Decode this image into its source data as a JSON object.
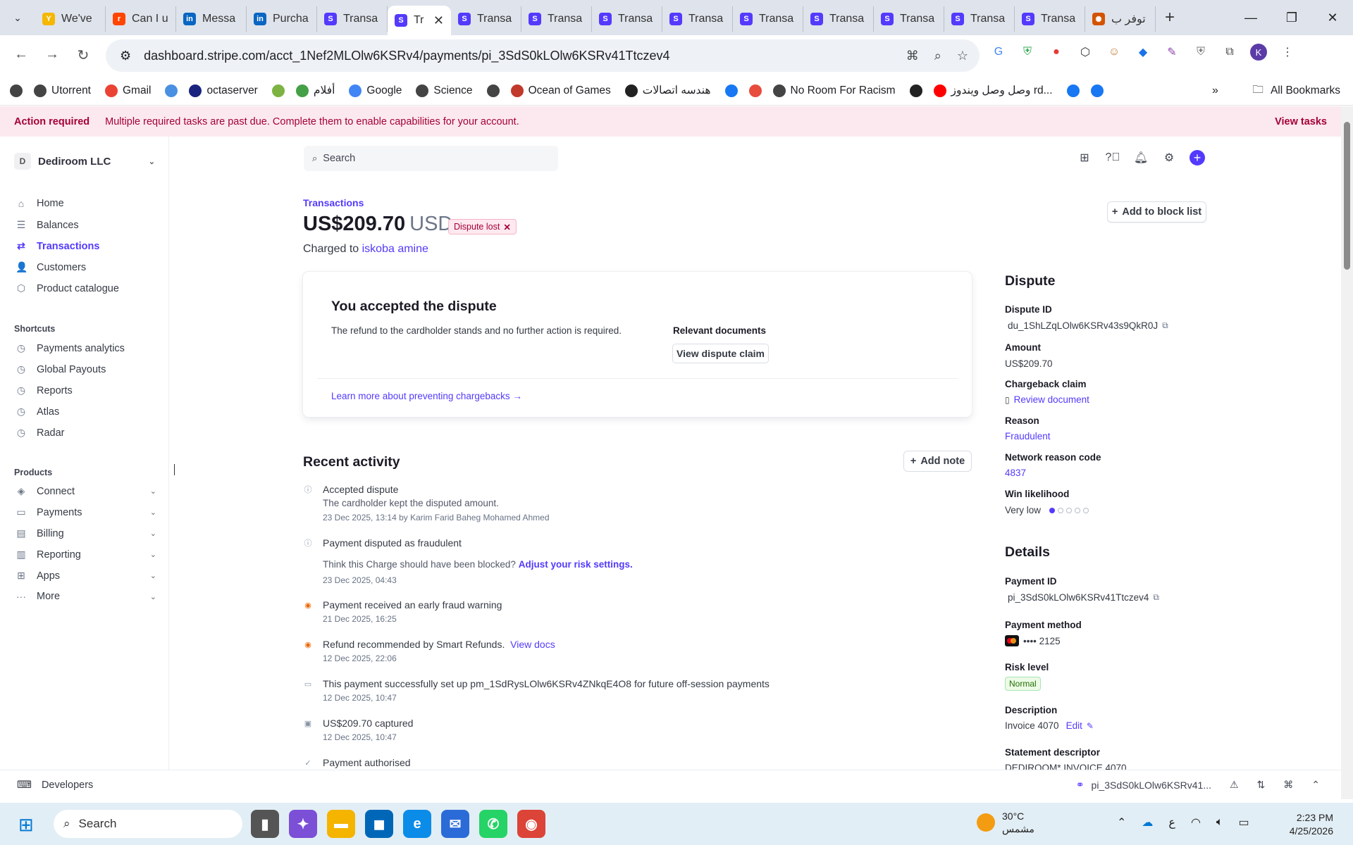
{
  "browser": {
    "tabs": [
      {
        "label": "We've",
        "color": "#f5b700",
        "glyph": "Y"
      },
      {
        "label": "Can I u",
        "color": "#ff4500",
        "glyph": "r"
      },
      {
        "label": "Messa",
        "color": "#0a66c2",
        "glyph": "in"
      },
      {
        "label": "Purcha",
        "color": "#0a66c2",
        "glyph": "in"
      },
      {
        "label": "Transa",
        "color": "#533afd",
        "glyph": "S"
      },
      {
        "label": "Tr",
        "color": "#533afd",
        "glyph": "S",
        "active": true
      },
      {
        "label": "Transa",
        "color": "#533afd",
        "glyph": "S"
      },
      {
        "label": "Transa",
        "color": "#533afd",
        "glyph": "S"
      },
      {
        "label": "Transa",
        "color": "#533afd",
        "glyph": "S"
      },
      {
        "label": "Transa",
        "color": "#533afd",
        "glyph": "S"
      },
      {
        "label": "Transa",
        "color": "#533afd",
        "glyph": "S"
      },
      {
        "label": "Transa",
        "color": "#533afd",
        "glyph": "S"
      },
      {
        "label": "Transa",
        "color": "#533afd",
        "glyph": "S"
      },
      {
        "label": "Transa",
        "color": "#533afd",
        "glyph": "S"
      },
      {
        "label": "Transa",
        "color": "#533afd",
        "glyph": "S"
      },
      {
        "label": "توفر ب",
        "color": "#d35400",
        "glyph": "✺"
      }
    ],
    "url": "dashboard.stripe.com/acct_1Nef2MLOlw6KSRv4/payments/pi_3SdS0kLOlw6KSRv41Ttczev4",
    "profile_initial": "K",
    "bookmarks": [
      {
        "label": "",
        "icon": "apps-icon",
        "color": "#444"
      },
      {
        "label": "Utorrent",
        "icon": "globe-icon",
        "color": "#444"
      },
      {
        "label": "Gmail",
        "icon": "gmail-icon",
        "color": "#ea4335"
      },
      {
        "label": "",
        "icon": "loader-icon",
        "color": "#4a90e2"
      },
      {
        "label": "octaserver",
        "icon": "s-icon",
        "color": "#1a237e"
      },
      {
        "label": "",
        "icon": "a-icon",
        "color": "#7cb342"
      },
      {
        "label": "أفلام",
        "icon": "grid-icon",
        "color": "#43a047"
      },
      {
        "label": "Google",
        "icon": "google-icon",
        "color": "#4285f4"
      },
      {
        "label": "Science",
        "icon": "globe-icon",
        "color": "#444"
      },
      {
        "label": "",
        "icon": "globe-icon",
        "color": "#444"
      },
      {
        "label": "Ocean of Games",
        "icon": "gamepad-icon",
        "color": "#c0392b"
      },
      {
        "label": "هندسه اتصالات",
        "icon": "m-icon",
        "color": "#222"
      },
      {
        "label": "",
        "icon": "facebook-icon",
        "color": "#1877f2"
      },
      {
        "label": "",
        "icon": "pin-icon",
        "color": "#e74c3c"
      },
      {
        "label": "No Room For Racism",
        "icon": "globe-icon",
        "color": "#444"
      },
      {
        "label": "",
        "icon": "v-icon",
        "color": "#222"
      },
      {
        "label": "وصل وصل ويندوز rd...",
        "icon": "youtube-icon",
        "color": "#ff0000"
      },
      {
        "label": "",
        "icon": "facebook-icon",
        "color": "#1877f2"
      },
      {
        "label": "",
        "icon": "facebook-icon",
        "color": "#1877f2"
      }
    ],
    "all_bookmarks": "All Bookmarks"
  },
  "banner": {
    "title": "Action required",
    "message": "Multiple required tasks are past due. Complete them to enable capabilities for your account.",
    "action": "View tasks"
  },
  "sidebar": {
    "account_initial": "D",
    "account_name": "Dediroom LLC",
    "main": [
      {
        "label": "Home",
        "icon": "⌂"
      },
      {
        "label": "Balances",
        "icon": "☰"
      },
      {
        "label": "Transactions",
        "icon": "⇄",
        "active": true
      },
      {
        "label": "Customers",
        "icon": "👤"
      },
      {
        "label": "Product catalogue",
        "icon": "⬡"
      }
    ],
    "shortcuts_label": "Shortcuts",
    "shortcuts": [
      "Payments analytics",
      "Global Payouts",
      "Reports",
      "Atlas",
      "Radar"
    ],
    "products_label": "Products",
    "products": [
      {
        "label": "Connect",
        "icon": "◈"
      },
      {
        "label": "Payments",
        "icon": "▭"
      },
      {
        "label": "Billing",
        "icon": "▤"
      },
      {
        "label": "Reporting",
        "icon": "▥"
      },
      {
        "label": "Apps",
        "icon": "⊞"
      },
      {
        "label": "More",
        "icon": "···"
      }
    ],
    "developers": "Developers"
  },
  "header": {
    "search_placeholder": "Search"
  },
  "payment": {
    "breadcrumb": "Transactions",
    "amount": "US$209.70",
    "currency": "USD",
    "status": "Dispute lost",
    "charged_prefix": "Charged to",
    "customer": "iskoba amine",
    "block_button": "Add to block list"
  },
  "dispute_card": {
    "title": "You accepted the dispute",
    "description": "The refund to the cardholder stands and no further action is required.",
    "docs_label": "Relevant documents",
    "docs_button": "View dispute claim",
    "learn_more": "Learn more about preventing chargebacks →"
  },
  "activity": {
    "title": "Recent activity",
    "add_note": "Add note",
    "items": [
      {
        "title": "Accepted dispute",
        "sub": "The cardholder kept the disputed amount.",
        "date": "23 Dec 2025, 13:14 by Karim Farid Baheg Mohamed Ahmed"
      },
      {
        "title": "Payment disputed as fraudulent",
        "sub_prefix": "Think this Charge should have been blocked?",
        "sub_link": "Adjust your risk settings.",
        "date": "23 Dec 2025, 04:43"
      },
      {
        "title": "Payment received an early fraud warning",
        "date": "21 Dec 2025, 16:25"
      },
      {
        "title": "Refund recommended by Smart Refunds.",
        "title_link": "View docs",
        "date": "12 Dec 2025, 22:06"
      },
      {
        "title": "This payment successfully set up pm_1SdRysLOlw6KSRv4ZNkqE4O8 for future off-session payments",
        "date": "12 Dec 2025, 10:47"
      },
      {
        "title": "US$209.70 captured",
        "date": "12 Dec 2025, 10:47"
      },
      {
        "title": "Payment authorised"
      }
    ]
  },
  "dispute_panel": {
    "title": "Dispute",
    "id_label": "Dispute ID",
    "id_value": "du_1ShLZqLOlw6KSRv43s9QkR0J",
    "amount_label": "Amount",
    "amount_value": "US$209.70",
    "claim_label": "Chargeback claim",
    "claim_value": "Review document",
    "reason_label": "Reason",
    "reason_value": "Fraudulent",
    "code_label": "Network reason code",
    "code_value": "4837",
    "win_label": "Win likelihood",
    "win_value": "Very low",
    "win_level": 1,
    "win_max": 5
  },
  "details_panel": {
    "title": "Details",
    "pid_label": "Payment ID",
    "pid_value": "pi_3SdS0kLOlw6KSRv41Ttczev4",
    "method_label": "Payment method",
    "method_value": "•••• 2125",
    "risk_label": "Risk level",
    "risk_value": "Normal",
    "desc_label": "Description",
    "desc_value": "Invoice 4070",
    "desc_edit": "Edit",
    "stmt_label": "Statement descriptor",
    "stmt_value": "DEDIROOM* INVOICE 4070"
  },
  "devbar": {
    "payment_ref": "pi_3SdS0kLOlw6KSRv41..."
  },
  "taskbar": {
    "search": "Search",
    "temp": "30°C",
    "weather": "مشمس",
    "lang": "ع",
    "time": "2:23 PM",
    "date": "4/25/2026"
  }
}
